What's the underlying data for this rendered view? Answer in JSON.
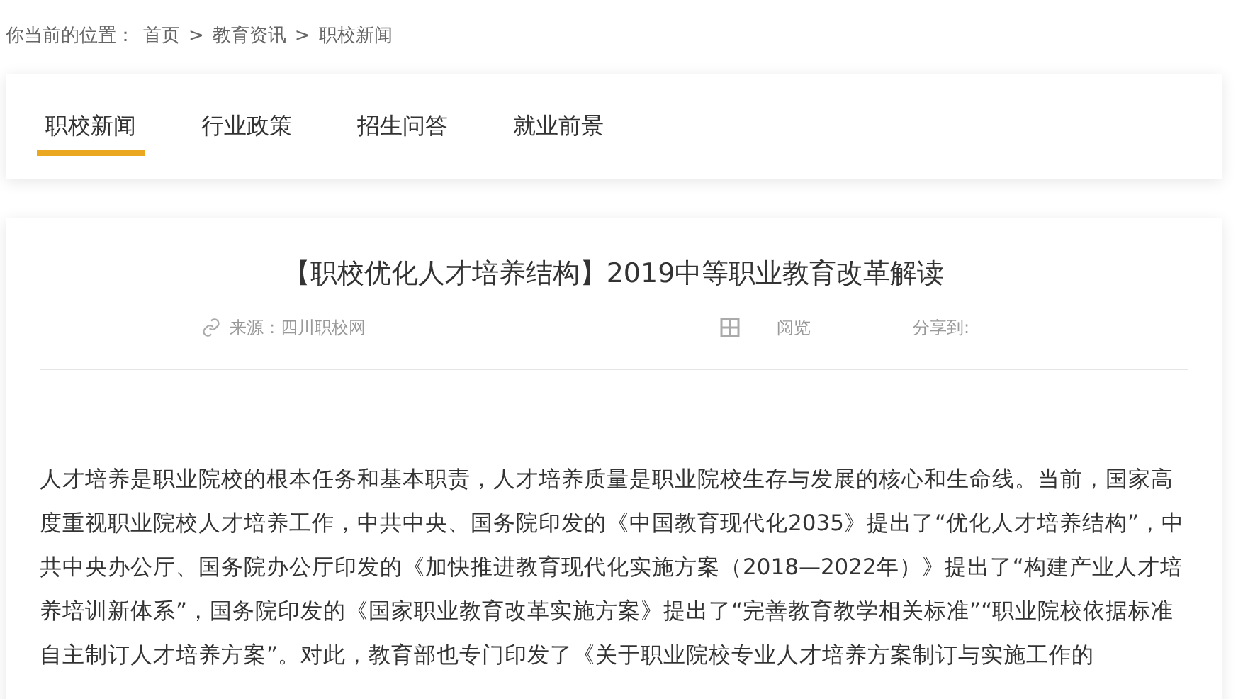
{
  "breadcrumb": {
    "label": "你当前的位置：",
    "items": [
      "首页",
      "教育资讯",
      "职校新闻"
    ],
    "separator": ">"
  },
  "tabs": [
    {
      "label": "职校新闻",
      "selected": true
    },
    {
      "label": "行业政策",
      "selected": false
    },
    {
      "label": "招生问答",
      "selected": false
    },
    {
      "label": "就业前景",
      "selected": false
    }
  ],
  "article": {
    "title": "【职校优化人才培养结构】2019中等职业教育改革解读",
    "source": "来源：四川职校网",
    "views": "阅览",
    "share": "分享到:",
    "body": "人才培养是职业院校的根本任务和基本职责，人才培养质量是职业院校生存与发展的核心和生命线。当前，国家高度重视职业院校人才培养工作，中共中央、国务院印发的《中国教育现代化2035》提出了“优化人才培养结构”，中共中央办公厅、国务院办公厅印发的《加快推进教育现代化实施方案（2018—2022年）》提出了“构建产业人才培养培训新体系”，国务院印发的《国家职业教育改革实施方案》提出了“完善教育教学相关标准”“职业院校依据标准自主制订人才培养方案”。对此，教育部也专门印发了《关于职业院校专业人才培养方案制订与实施工作的"
  }
}
